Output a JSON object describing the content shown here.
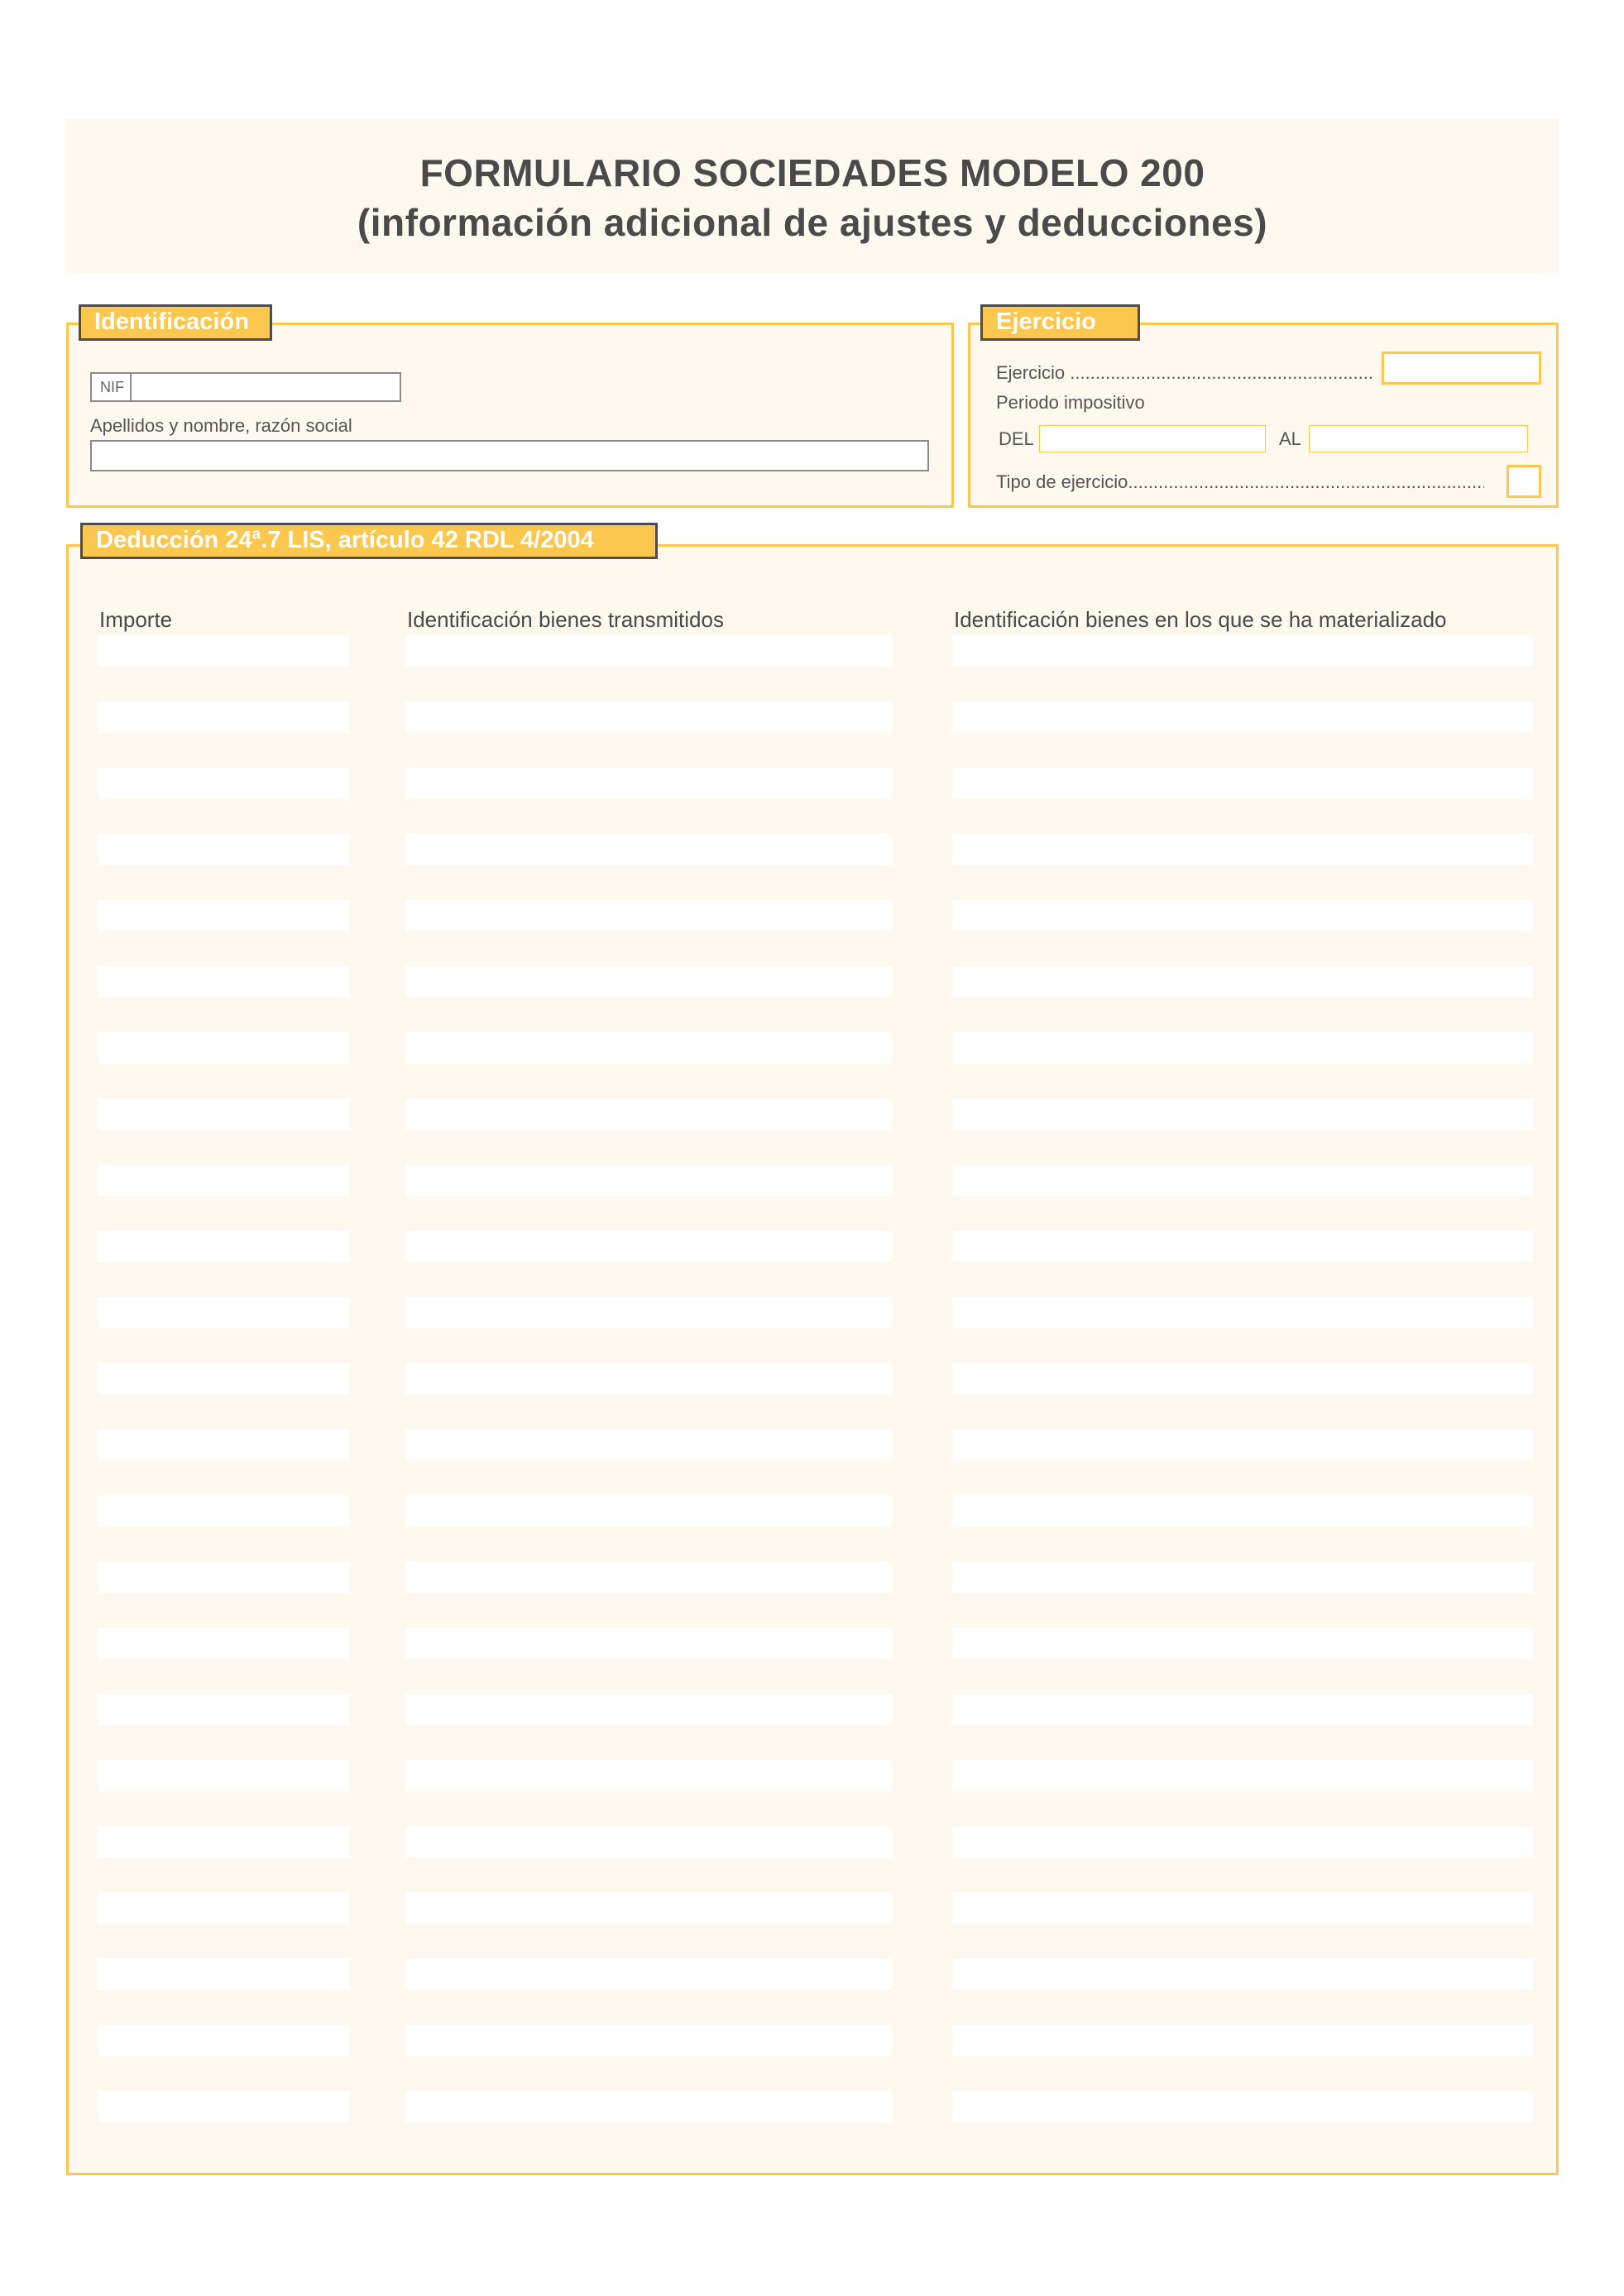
{
  "title": {
    "line1": "FORMULARIO SOCIEDADES MODELO 200",
    "line2": "(información adicional de ajustes y deducciones)"
  },
  "identificacion": {
    "heading": "Identificación",
    "nif_label": "NIF",
    "nif_value": "",
    "name_label": "Apellidos y nombre, razón social",
    "name_value": ""
  },
  "ejercicio": {
    "heading": "Ejercicio",
    "ejercicio_label": "Ejercicio",
    "ejercicio_value": "",
    "periodo_label": "Periodo impositivo",
    "del_label": "DEL",
    "del_value": "",
    "al_label": "AL",
    "al_value": "",
    "tipo_label": "Tipo de ejercicio",
    "tipo_value": ""
  },
  "deduccion": {
    "heading": "Deducción 24ª.7 LIS, artículo 42 RDL 4/2004",
    "columns": [
      "Importe",
      "Identificación bienes transmitidos",
      "Identificación bienes en los que se ha materializado"
    ],
    "row_count": 23
  },
  "colors": {
    "accent": "#fbc74e",
    "panel_bg": "#fef8ee",
    "tab_border": "#4d4d4d",
    "text": "#4a4a4a"
  }
}
